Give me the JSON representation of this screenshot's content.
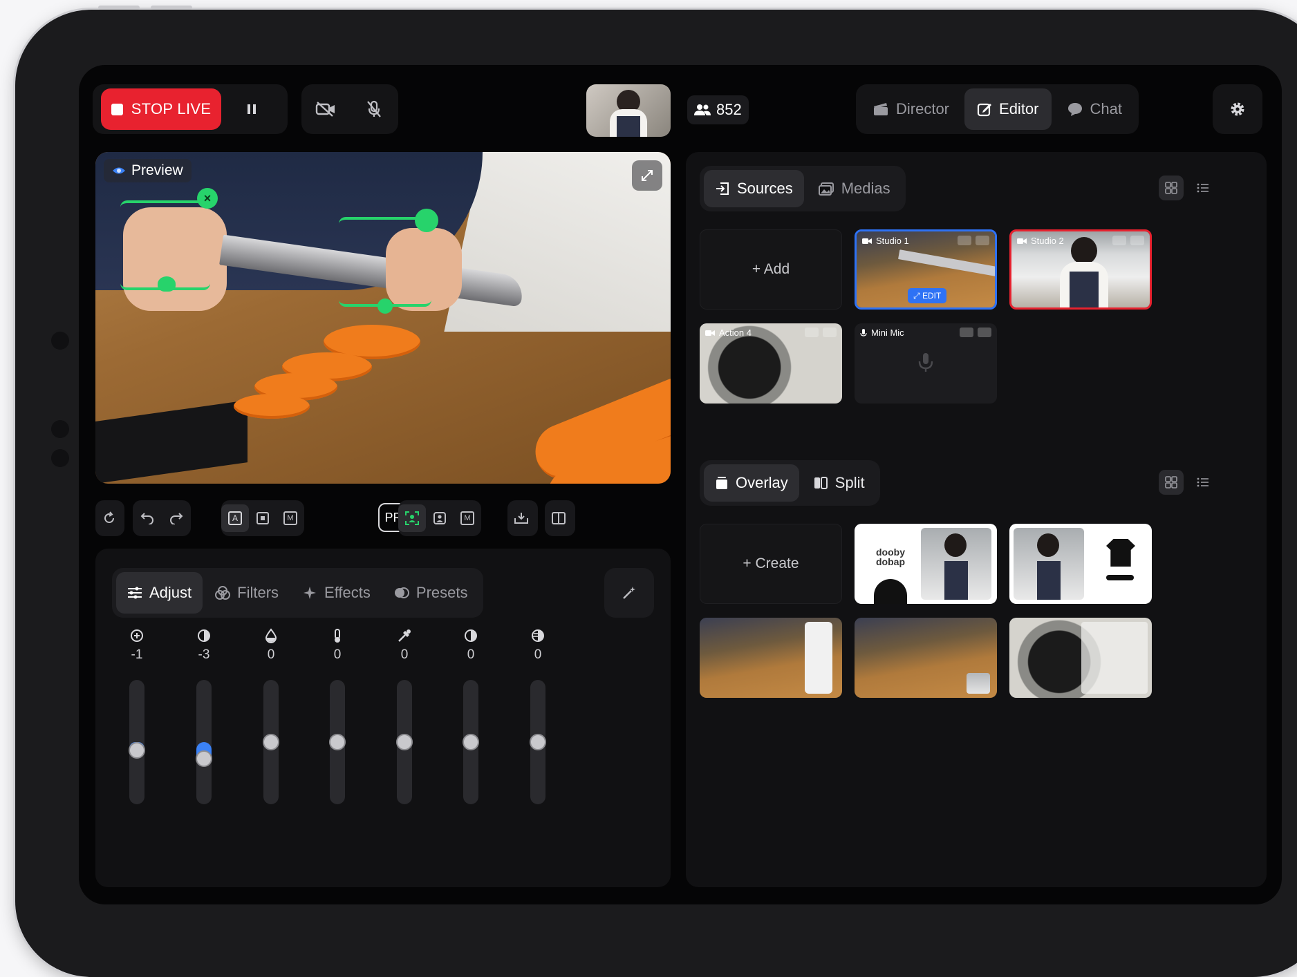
{
  "topbar": {
    "stop_live_label": "STOP LIVE",
    "viewer_count": "852",
    "modes": [
      {
        "label": "Director",
        "active": false
      },
      {
        "label": "Editor",
        "active": true
      },
      {
        "label": "Chat",
        "active": false
      }
    ]
  },
  "preview": {
    "label": "Preview"
  },
  "toolbar": {
    "pro_label": "PRO",
    "group_a": [
      "A",
      "M"
    ],
    "group_b": [
      "M"
    ]
  },
  "adjust": {
    "tabs": [
      {
        "label": "Adjust",
        "active": true
      },
      {
        "label": "Filters",
        "active": false
      },
      {
        "label": "Effects",
        "active": false
      },
      {
        "label": "Presets",
        "active": false
      }
    ],
    "sliders": [
      {
        "icon": "exposure-icon",
        "value": "-1"
      },
      {
        "icon": "contrast-icon",
        "value": "-3"
      },
      {
        "icon": "saturation-icon",
        "value": "0"
      },
      {
        "icon": "temperature-icon",
        "value": "0"
      },
      {
        "icon": "tint-icon",
        "value": "0"
      },
      {
        "icon": "highlights-icon",
        "value": "0"
      },
      {
        "icon": "shadows-icon",
        "value": "0"
      }
    ]
  },
  "sources": {
    "tabs": [
      {
        "label": "Sources",
        "active": true
      },
      {
        "label": "Medias",
        "active": false
      }
    ],
    "add_label": "+ Add",
    "tiles": [
      {
        "label": "Studio 1",
        "badge": "EDIT",
        "border": "#2e72f5"
      },
      {
        "label": "Studio 2",
        "border": "#e8222f"
      },
      {
        "label": "Action 4"
      },
      {
        "label": "Mini Mic"
      }
    ]
  },
  "overlay": {
    "tabs": [
      {
        "label": "Overlay",
        "active": true
      },
      {
        "label": "Split",
        "active": false
      }
    ],
    "create_label": "+ Create",
    "logo_text": "dooby dobap"
  },
  "colors": {
    "live_red": "#e8222f",
    "accent_blue": "#2e72f5",
    "track_green": "#27d36b"
  }
}
